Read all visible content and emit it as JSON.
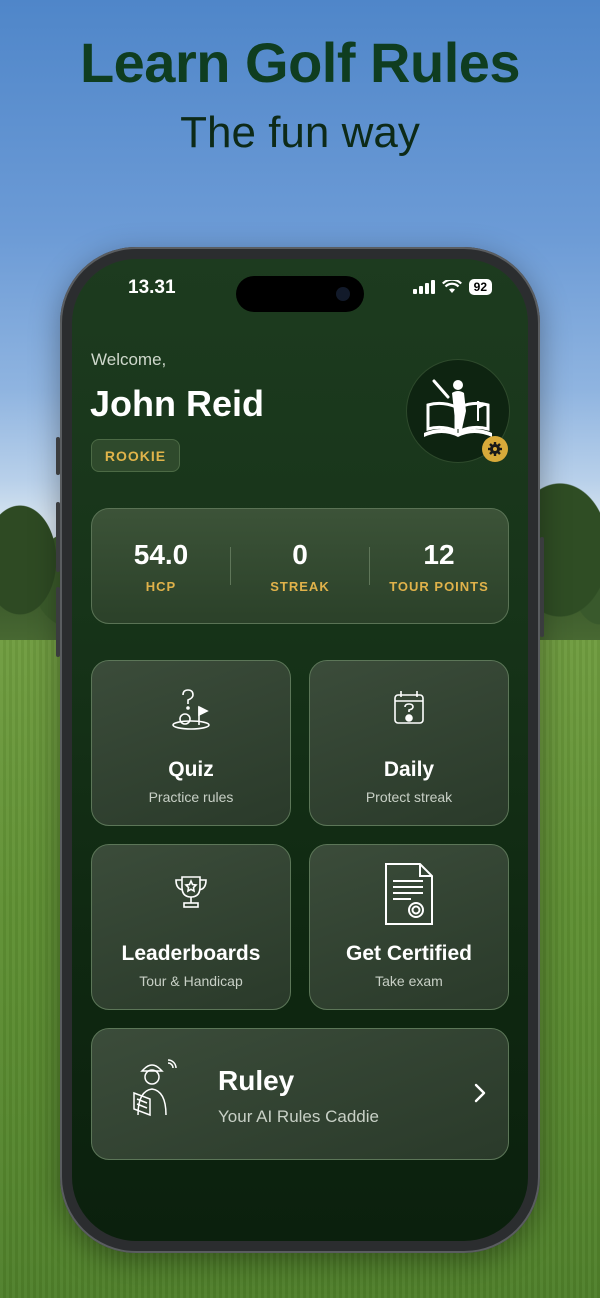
{
  "promo": {
    "headline": "Learn Golf Rules",
    "subheadline": "The fun way"
  },
  "status_bar": {
    "time": "13.31",
    "battery": "92"
  },
  "profile": {
    "greeting": "Welcome,",
    "name": "John Reid",
    "rank_badge": "ROOKIE",
    "avatar_icon": "golfer-book-logo-icon",
    "settings_icon": "gear-icon"
  },
  "stats": [
    {
      "value": "54.0",
      "label": "HCP"
    },
    {
      "value": "0",
      "label": "STREAK"
    },
    {
      "value": "12",
      "label": "TOUR POINTS"
    }
  ],
  "menu": {
    "quiz": {
      "title": "Quiz",
      "subtitle": "Practice rules",
      "icon": "golf-question-icon"
    },
    "daily": {
      "title": "Daily",
      "subtitle": "Protect streak",
      "icon": "calendar-question-icon"
    },
    "leaderboards": {
      "title": "Leaderboards",
      "subtitle": "Tour & Handicap",
      "icon": "trophy-icon"
    },
    "certified": {
      "title": "Get Certified",
      "subtitle": "Take exam",
      "icon": "certificate-icon"
    }
  },
  "ruley": {
    "title": "Ruley",
    "subtitle": "Your AI Rules Caddie",
    "icon": "caddie-reading-icon",
    "chevron_icon": "chevron-right-icon"
  },
  "colors": {
    "accent_gold": "#e0b24a",
    "headline_green": "#0f3d20",
    "screen_bg": "#173419"
  }
}
